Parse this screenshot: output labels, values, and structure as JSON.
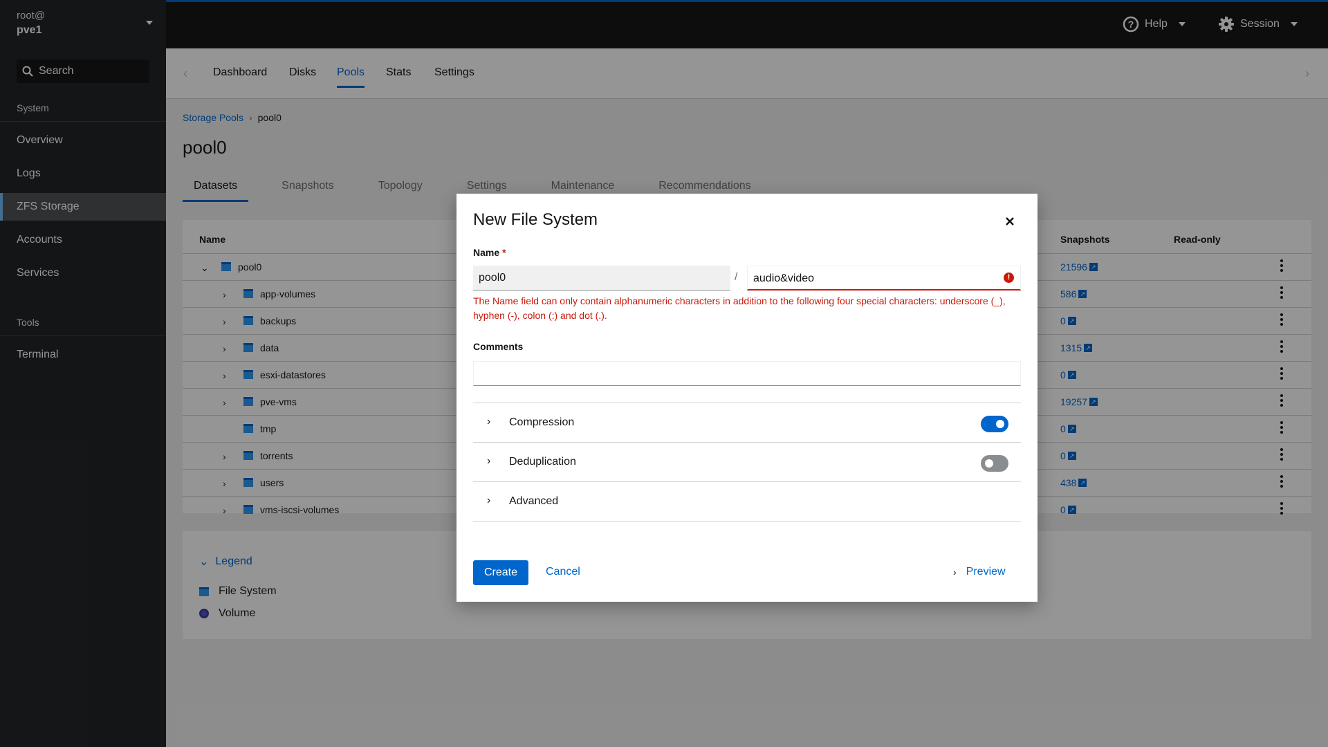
{
  "sidebar": {
    "user": "root@",
    "host": "pve1",
    "search_label": "Search",
    "section_system": "System",
    "items": [
      {
        "label": "Overview"
      },
      {
        "label": "Logs"
      },
      {
        "label": "ZFS Storage",
        "active": true
      },
      {
        "label": "Accounts"
      },
      {
        "label": "Services"
      }
    ],
    "section_tools": "Tools",
    "tools_items": [
      {
        "label": "Terminal"
      }
    ]
  },
  "masthead": {
    "help_label": "Help",
    "session_label": "Session"
  },
  "top_tabs": {
    "prev_arrow": "‹",
    "next_arrow": "›",
    "items": [
      {
        "label": "Dashboard"
      },
      {
        "label": "Disks"
      },
      {
        "label": "Pools",
        "active": true
      },
      {
        "label": "Stats"
      },
      {
        "label": "Settings"
      }
    ]
  },
  "breadcrumb": {
    "parent": "Storage Pools",
    "separator": "›",
    "current": "pool0"
  },
  "page_title": "pool0",
  "pool_tabs": [
    {
      "label": "Datasets",
      "active": true
    },
    {
      "label": "Snapshots"
    },
    {
      "label": "Topology"
    },
    {
      "label": "Settings"
    },
    {
      "label": "Maintenance"
    },
    {
      "label": "Recommendations"
    }
  ],
  "table": {
    "columns": {
      "name": "Name",
      "snapshots": "Snapshots",
      "readonly": "Read-only"
    },
    "rows": [
      {
        "name": "pool0",
        "snapshots": "21596",
        "expanded": true
      },
      {
        "name": "app-volumes",
        "snapshots": "586"
      },
      {
        "name": "backups",
        "snapshots": "0"
      },
      {
        "name": "data",
        "snapshots": "1315"
      },
      {
        "name": "esxi-datastores",
        "snapshots": "0"
      },
      {
        "name": "pve-vms",
        "snapshots": "19257"
      },
      {
        "name": "tmp",
        "snapshots": "0"
      },
      {
        "name": "torrents",
        "snapshots": "0"
      },
      {
        "name": "users",
        "snapshots": "438"
      },
      {
        "name": "vms-iscsi-volumes",
        "snapshots": "0"
      }
    ]
  },
  "legend": {
    "toggle_label": "Legend",
    "items": [
      {
        "label": "File System"
      },
      {
        "label": "Volume"
      }
    ]
  },
  "modal": {
    "title": "New File System",
    "close_glyph": "×",
    "name_label": "Name",
    "required_mark": "*",
    "pool_value": "pool0",
    "slash": "/",
    "name_value": "audio&video",
    "error_glyph": "!",
    "error_message": "The Name field can only contain alphanumeric characters in addition to the following four special characters: underscore (_), hyphen (-), colon (:) and dot (.).",
    "comments_label": "Comments",
    "comments_value": "",
    "sections": [
      {
        "label": "Compression",
        "toggle": true
      },
      {
        "label": "Deduplication",
        "toggle": false
      },
      {
        "label": "Advanced"
      }
    ],
    "create_label": "Create",
    "cancel_label": "Cancel",
    "preview_label": "Preview"
  },
  "colors": {
    "accent": "#0066cc",
    "error": "#c9190b",
    "sidebar_bg": "#212427",
    "masthead_bg": "#151515"
  }
}
